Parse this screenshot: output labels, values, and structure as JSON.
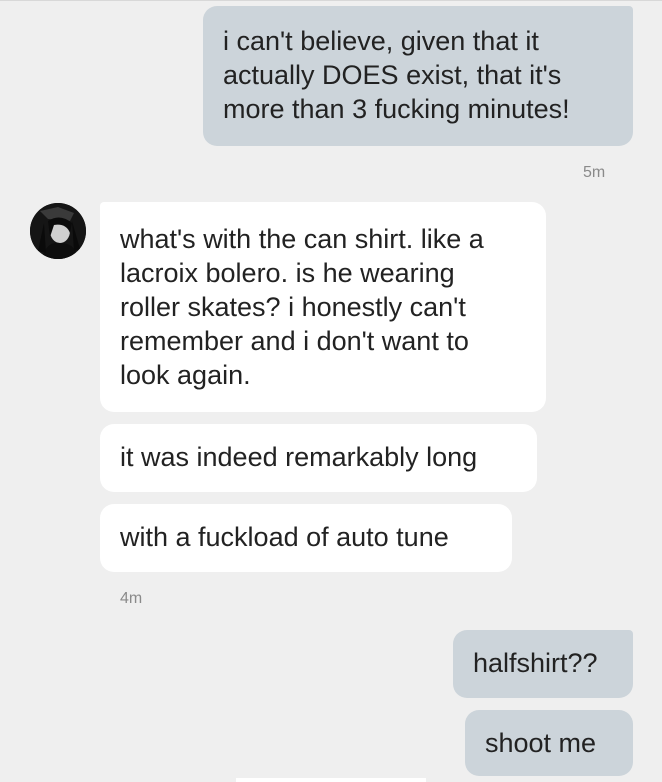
{
  "messages": [
    {
      "id": "m1",
      "direction": "sent",
      "text": "i can't believe, given that it\nactually DOES exist, that it's\nmore than 3 fucking minutes!"
    },
    {
      "id": "m2",
      "direction": "received",
      "text": "what's with the can shirt. like a\nlacroix bolero. is he wearing\nroller skates? i honestly can't\nremember and i don't want to\nlook again."
    },
    {
      "id": "m3",
      "direction": "received",
      "text": "it was indeed remarkably long"
    },
    {
      "id": "m4",
      "direction": "received",
      "text": "with a fuckload of auto tune"
    },
    {
      "id": "m5",
      "direction": "sent",
      "text": "halfshirt??"
    },
    {
      "id": "m6",
      "direction": "sent",
      "text": "shoot me"
    }
  ],
  "timestamps": {
    "sent_group_1": "5m",
    "received_group": "4m"
  },
  "colors": {
    "background": "#efefef",
    "sent_bubble": "#ccd4da",
    "received_bubble": "#ffffff",
    "timestamp_text": "#8a8a8a"
  },
  "icons": {
    "contact_avatar": "avatar-photo"
  }
}
